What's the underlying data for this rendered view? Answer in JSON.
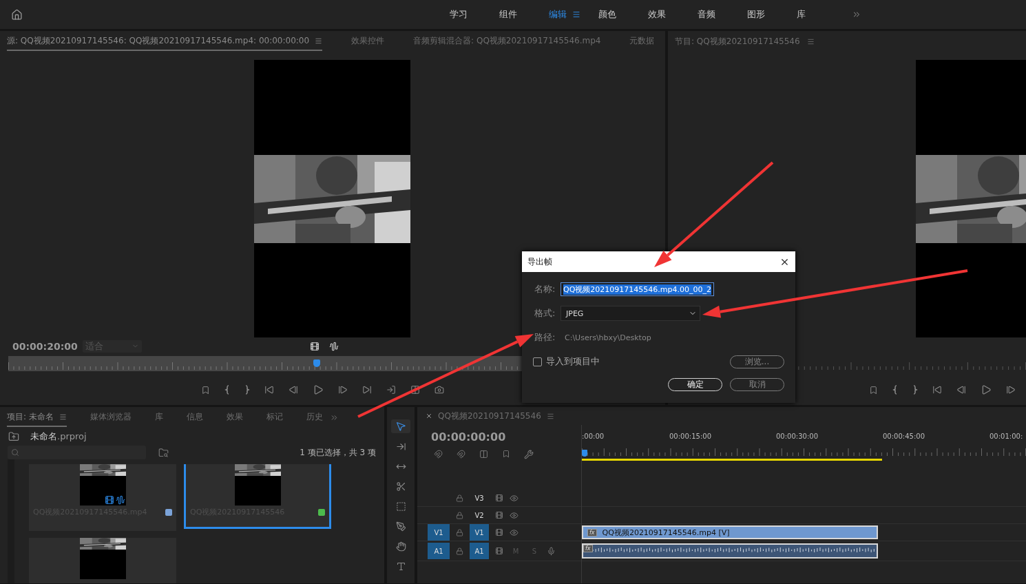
{
  "workspace_tabs": [
    {
      "label": "学习",
      "selected": false
    },
    {
      "label": "组件",
      "selected": false
    },
    {
      "label": "编辑",
      "selected": true
    },
    {
      "label": "颜色",
      "selected": false
    },
    {
      "label": "效果",
      "selected": false
    },
    {
      "label": "音频",
      "selected": false
    },
    {
      "label": "图形",
      "selected": false
    },
    {
      "label": "库",
      "selected": false
    }
  ],
  "source_monitor": {
    "tabs": [
      {
        "label": "源: QQ视频20210917145546: QQ视频20210917145546.mp4: 00:00:00:00",
        "selected": true
      },
      {
        "label": "效果控件",
        "selected": false
      },
      {
        "label": "音频剪辑混合器: QQ视频20210917145546.mp4",
        "selected": false
      },
      {
        "label": "元数据",
        "selected": false
      }
    ],
    "timecode": "00:00:20:00",
    "fit": "适合",
    "scrubber": {
      "level": 0.47
    }
  },
  "program_monitor": {
    "title": "节目: QQ视频20210917145546"
  },
  "export_frame_dialog": {
    "title": "导出帧",
    "name_label": "名称:",
    "name_value": "QQ视频20210917145546.mp4.00_00_2",
    "format_label": "格式:",
    "format_value": "JPEG",
    "path_label": "路径:",
    "path_value": "C:\\Users\\hbxy\\Desktop",
    "import_label": "导入到项目中",
    "import_checked": false,
    "browse": "浏览...",
    "ok": "确定",
    "cancel": "取消"
  },
  "project_panel": {
    "tabs": [
      {
        "label": "项目: 未命名",
        "selected": true
      },
      {
        "label": "媒体浏览器",
        "selected": false
      },
      {
        "label": "库",
        "selected": false
      },
      {
        "label": "信息",
        "selected": false
      },
      {
        "label": "效果",
        "selected": false
      },
      {
        "label": "标记",
        "selected": false
      },
      {
        "label": "历史",
        "selected": false
      }
    ],
    "project_name": "未命名",
    "project_ext": ".prproj",
    "selection_summary": "1 项已选择，共 3 项",
    "items": [
      {
        "name": "QQ视频20210917145546.mp4",
        "color": "#7ba3d9",
        "selected": false,
        "media_badges": true
      },
      {
        "name": "QQ视频20210917145546",
        "color": "#4cbb4c",
        "selected": true,
        "media_badges": false
      },
      {
        "selected": false,
        "media_badges": false
      }
    ]
  },
  "timeline": {
    "title": "QQ视频20210917145546",
    "timecode": "00:00:00:00",
    "ruler_labels": [
      ":00:00",
      "00:00:15:00",
      "00:00:30:00",
      "00:00:45:00",
      "00:01:00:"
    ],
    "work_area": {
      "level": 0.676
    },
    "playhead": {
      "level": 0
    },
    "tracks": [
      {
        "kind": "video",
        "label": "V3",
        "targeted": false
      },
      {
        "kind": "video",
        "label": "V2",
        "targeted": false
      },
      {
        "kind": "video",
        "label": "V1",
        "targeted": true,
        "source": "V1"
      },
      {
        "kind": "audio",
        "label": "A1",
        "targeted": true,
        "source": "A1",
        "mute": "M",
        "solo": "S"
      }
    ],
    "clips": [
      {
        "kind": "video",
        "badge": "fx",
        "name": "QQ视频20210917145546.mp4 [V]"
      },
      {
        "kind": "audio",
        "badge": "fx"
      }
    ]
  }
}
